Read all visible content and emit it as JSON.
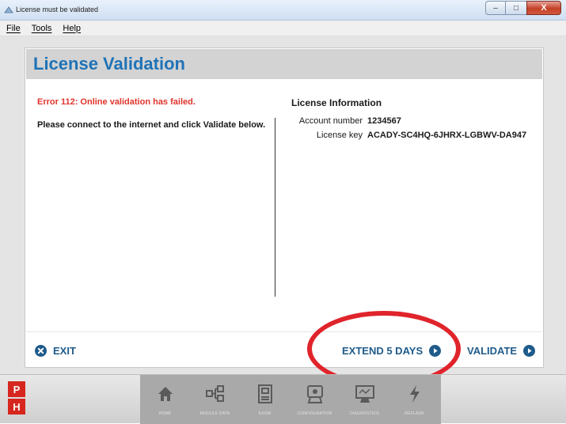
{
  "window": {
    "title": "License must be validated",
    "buttons": {
      "minimize": "–",
      "maximize": "□",
      "close": "X"
    }
  },
  "menu": [
    {
      "label": "File"
    },
    {
      "label": "Tools"
    },
    {
      "label": "Help"
    }
  ],
  "panel": {
    "title": "License Validation",
    "error": "Error 112: Online validation has failed.",
    "message": "Please connect to the internet and click Validate below.",
    "info_heading": "License Information",
    "account_label": "Account number",
    "account_value": "1234567",
    "license_label": "License key",
    "license_value": "ACADY-SC4HQ-6JHRX-LGBWV-DA947"
  },
  "footer": {
    "exit_label": "EXIT",
    "extend_label": "EXTEND 5 DAYS",
    "validate_label": "VALIDATE"
  },
  "taskbar": {
    "logo_top": "P",
    "logo_bottom": "H",
    "nav": [
      {
        "label": "HOME",
        "icon": "home-icon"
      },
      {
        "label": "MODULE DATA",
        "icon": "module-data-icon"
      },
      {
        "label": "EXOM",
        "icon": "exom-icon"
      },
      {
        "label": "CONFIGURATION",
        "icon": "configuration-icon"
      },
      {
        "label": "DIAGNOSTICS",
        "icon": "diagnostics-icon"
      },
      {
        "label": "REFLASH",
        "icon": "reflash-icon"
      }
    ]
  },
  "colors": {
    "title_blue": "#1f73b7",
    "error_red": "#e0332b",
    "button_blue": "#1f5b8a",
    "highlight_red": "#e0242b"
  }
}
